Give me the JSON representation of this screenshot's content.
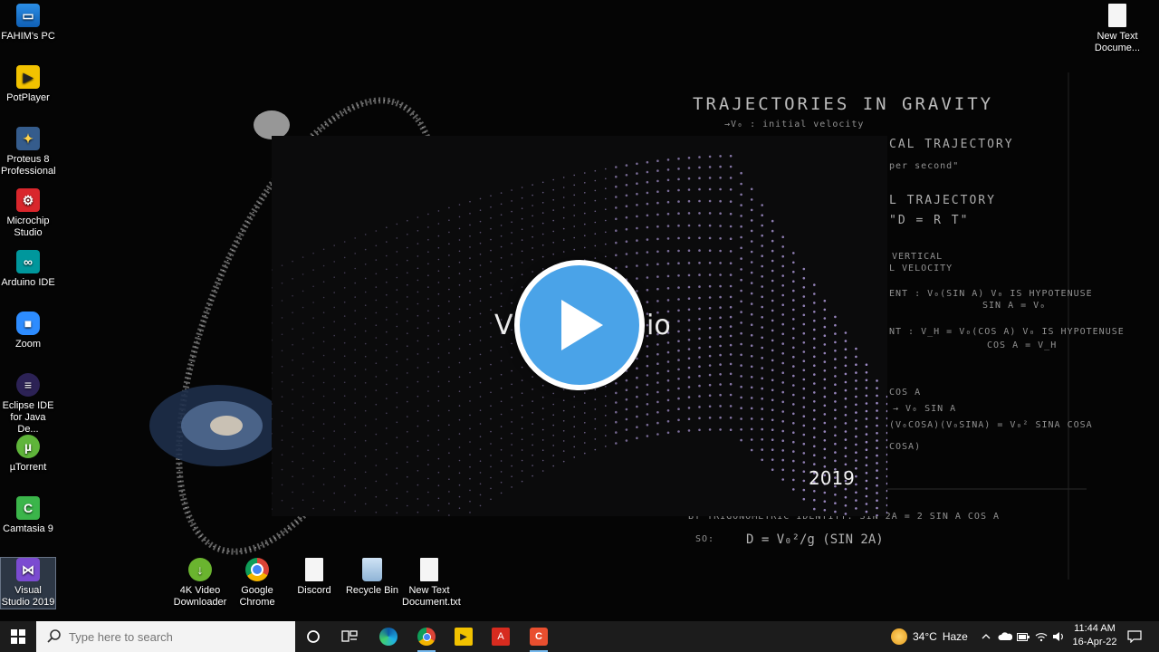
{
  "desktop": {
    "left_icons": [
      {
        "label": "FAHIM's PC",
        "icon": "computer-icon"
      },
      {
        "label": "PotPlayer",
        "icon": "potplayer-icon"
      },
      {
        "label": "Proteus 8 Professional",
        "icon": "proteus-icon"
      },
      {
        "label": "Microchip Studio",
        "icon": "microchip-icon"
      },
      {
        "label": "Arduino IDE",
        "icon": "arduino-icon"
      },
      {
        "label": "Zoom",
        "icon": "zoom-icon"
      },
      {
        "label": "Eclipse IDE for Java De...",
        "icon": "eclipse-icon"
      },
      {
        "label": "µTorrent",
        "icon": "utorrent-icon"
      },
      {
        "label": "Camtasia 9",
        "icon": "camtasia-icon"
      },
      {
        "label": "Visual Studio 2019",
        "icon": "visual-studio-icon"
      }
    ],
    "bottom_icons": [
      {
        "label": "4K Video Downloader",
        "icon": "4k-downloader-icon"
      },
      {
        "label": "Google Chrome",
        "icon": "chrome-icon"
      },
      {
        "label": "Discord",
        "icon": "file-icon"
      },
      {
        "label": "Recycle Bin",
        "icon": "recycle-bin-icon"
      },
      {
        "label": "New Text Document.txt",
        "icon": "text-file-icon"
      }
    ],
    "top_right_icon": {
      "label": "New Text Docume...",
      "icon": "text-file-icon"
    }
  },
  "wallpaper": {
    "title": "TRAJECTORIES IN GRAVITY",
    "lines": [
      "→V₀ : initial velocity",
      "CAL TRAJECTORY",
      "per second\"",
      "L TRAJECTORY",
      "\"D = R T\"",
      "VERTICAL",
      "L VELOCITY",
      "ENT :  V₀(SIN A)   V₀ IS HYPOTENUSE",
      "SIN A = V₀",
      "NT :   V_H = V₀(COS A)  V₀ IS HYPOTENUSE",
      "COS A = V_H",
      "COS A",
      "→ V₀ SIN A",
      "(V₀COSA)(V₀SINA) = V₀² SINA COSA",
      "COSA)",
      "BY TRIGONOMETRIC IDENTITY:  SIN 2A = 2 SIN A COS A",
      "SO:",
      "D = V₀²/g (SIN 2A)"
    ]
  },
  "video": {
    "title_left": "V",
    "title_right": "io",
    "year": "2019",
    "dot_color": "#b9a3e8"
  },
  "taskbar": {
    "search_placeholder": "Type here to search",
    "pinned": [
      "cortana-icon",
      "task-view-icon",
      "edge-icon",
      "chrome-icon",
      "potplayer-icon",
      "acrobat-icon",
      "camtasia-icon"
    ],
    "weather": {
      "temp": "34°C",
      "condition": "Haze"
    },
    "time": "11:44 AM",
    "date": "16-Apr-22"
  },
  "colors": {
    "taskbar": "#1c1c1c",
    "play": "#4aa3e8",
    "search": "#f3f3f3"
  }
}
